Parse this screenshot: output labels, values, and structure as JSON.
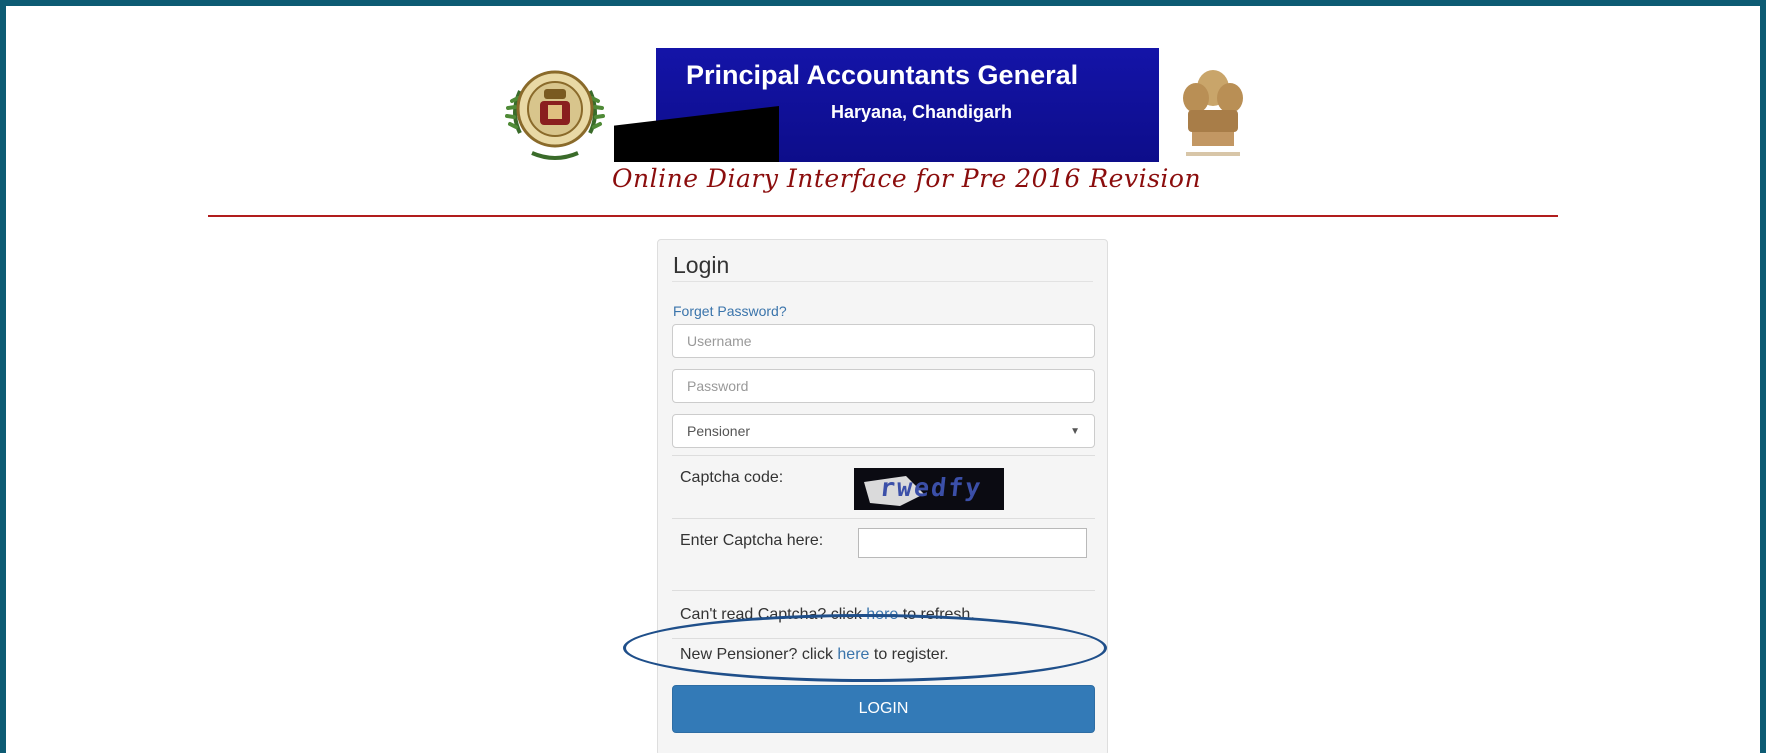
{
  "header": {
    "banner_title": "Principal Accountants General",
    "banner_subtitle": "Haryana, Chandigarh",
    "tagline": "Online Diary Interface for Pre 2016 Revision"
  },
  "login": {
    "title": "Login",
    "forgot_password": "Forget Password?",
    "username_placeholder": "Username",
    "password_placeholder": "Password",
    "user_type_selected": "Pensioner",
    "captcha_label": "Captcha code:",
    "captcha_text": "rwedfy",
    "enter_captcha_label": "Enter Captcha here:",
    "refresh_prefix": "Can't read Captcha? click ",
    "refresh_link": "here",
    "refresh_suffix": " to refresh.",
    "register_prefix": "New Pensioner? click ",
    "register_link": "here",
    "register_suffix": " to register.",
    "login_button": "LOGIN"
  },
  "colors": {
    "page_border": "#0d5b73",
    "banner_blue": "#1212a0",
    "tagline": "#8b0d0d",
    "link": "#3a74ab",
    "button": "#337ab7",
    "highlight": "#1f4f8a"
  },
  "icons": {
    "left_emblem": "cag-seal-icon",
    "right_emblem": "ashoka-emblem-icon",
    "select_caret": "chevron-down-icon"
  }
}
